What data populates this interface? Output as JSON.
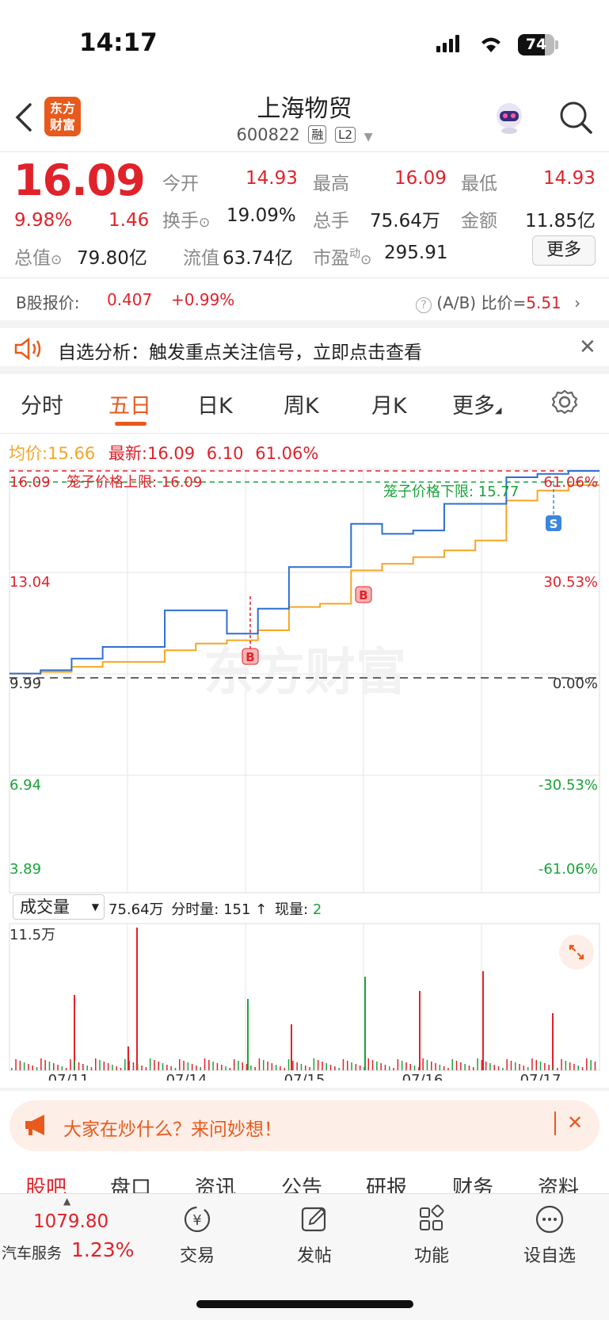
{
  "status_bar": {
    "time": "14:17",
    "battery": "74",
    "battery_level": 0.74
  },
  "header": {
    "logo_text": "东方财富",
    "stock_name": "上海物贸",
    "stock_code": "600822",
    "badge_rong": "融",
    "badge_l2": "L2"
  },
  "quote": {
    "price": "16.09",
    "change_pct": "9.98%",
    "change_amt": "1.46",
    "open_label": "今开",
    "open": "14.93",
    "high_label": "最高",
    "high": "16.09",
    "low_label": "最低",
    "low": "14.93",
    "turnover_label": "换手",
    "turnover": "19.09%",
    "volume_label": "总手",
    "volume": "75.64万",
    "amount_label": "金额",
    "amount": "11.85亿",
    "mktcap_label": "总值",
    "mktcap": "79.80亿",
    "float_label": "流值",
    "float_cap": "63.74亿",
    "pe_label": "市盈",
    "pe_sup": "动",
    "pe": "295.91",
    "more_label": "更多"
  },
  "b_share": {
    "label": "B股报价:",
    "price": "0.407",
    "change": "+0.99%",
    "ratio_label": "(A/B) 比价=",
    "ratio": "5.51"
  },
  "notice": {
    "text": "自选分析：触发重点关注信号，立即点击查看"
  },
  "tabs": [
    "分时",
    "五日",
    "日K",
    "周K",
    "月K",
    "更多"
  ],
  "active_tab": "五日",
  "chart_info": {
    "avg_label": "均价:",
    "avg": "15.66",
    "latest_label": "最新:",
    "latest": "16.09",
    "change": "6.10",
    "change_pct": "61.06%",
    "cage_upper": "笼子价格上限: 16.09",
    "cage_lower": "笼子价格下限: 15.77",
    "marker_b": "B",
    "marker_s": "S",
    "watermark": "东方财富"
  },
  "chart_data": {
    "type": "line",
    "y_left_ticks": [
      "16.09",
      "13.04",
      "9.99",
      "6.94",
      "3.89"
    ],
    "y_right_ticks": [
      "61.06%",
      "30.53%",
      "0.00%",
      "-30.53%",
      "-61.06%"
    ],
    "ylim": [
      3.89,
      16.09
    ],
    "base_price": 9.99,
    "x_dates": [
      "07/11",
      "07/14",
      "07/15",
      "07/16",
      "07/17"
    ],
    "series": [
      {
        "name": "最新",
        "color": "#2f6fcf",
        "values": [
          10.0,
          10.1,
          10.45,
          10.8,
          10.8,
          11.9,
          11.9,
          11.2,
          11.95,
          13.2,
          13.2,
          14.5,
          14.2,
          14.3,
          15.1,
          15.1,
          15.9,
          16.0,
          16.09,
          16.09
        ]
      },
      {
        "name": "均价",
        "color": "#f5a623",
        "values": [
          10.0,
          10.05,
          10.2,
          10.35,
          10.35,
          10.7,
          10.9,
          11.0,
          11.3,
          12.0,
          12.1,
          13.1,
          13.3,
          13.5,
          13.7,
          14.0,
          15.2,
          15.5,
          15.66,
          15.66
        ]
      }
    ]
  },
  "volume_info": {
    "select_label": "成交量",
    "total": "75.64万",
    "minute_label": "分时量:",
    "minute": "151",
    "now_label": "现量:",
    "now": "2",
    "max_tick": "11.5万"
  },
  "ask_banner": {
    "text": "大家在炒什么？来问妙想！"
  },
  "sub_tabs": [
    "股吧",
    "盘口",
    "资讯",
    "公告",
    "研报",
    "财务",
    "资料"
  ],
  "bottom_nav": {
    "index_value": "1079.80",
    "index_name": "汽车服务",
    "index_change": "1.23%",
    "items": [
      "交易",
      "发帖",
      "功能",
      "设自选"
    ]
  }
}
